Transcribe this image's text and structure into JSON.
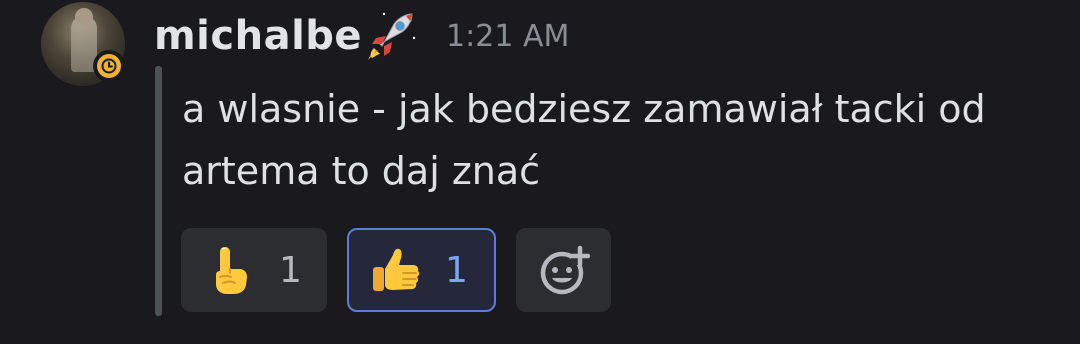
{
  "message": {
    "author": "michalbe",
    "author_badge_icon": "rocket-icon",
    "timestamp": "1:21 AM",
    "status": "idle",
    "status_color": "#f0b232",
    "text": "a wlasnie - jak bedziesz zamawiał tacki od artema to daj znać",
    "reactions": [
      {
        "icon": "index-pointing-up-emoji",
        "count": "1",
        "selected": false
      },
      {
        "icon": "thumbs-up-emoji",
        "count": "1",
        "selected": true
      }
    ],
    "add_reaction_icon": "add-reaction-icon"
  },
  "colors": {
    "background": "#1a1a1e",
    "selected_accent": "#5a7fd6"
  }
}
